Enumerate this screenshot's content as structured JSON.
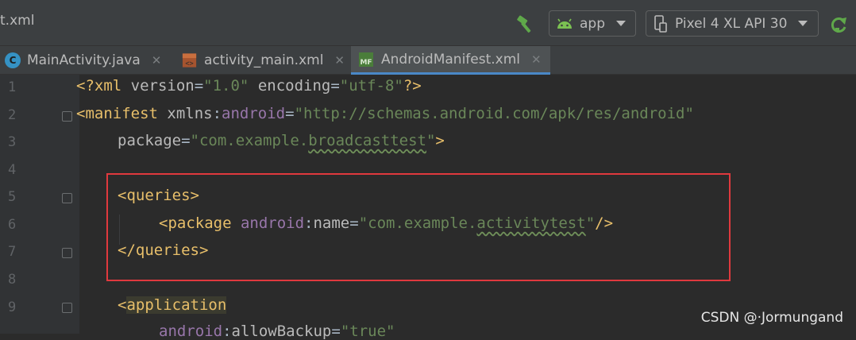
{
  "toolbar": {
    "file_title": "t.xml",
    "app_config": "app",
    "device": "Pixel 4 XL API 30",
    "icons": [
      "hammer-icon",
      "android-icon",
      "device-icon",
      "run-refresh-icon"
    ]
  },
  "tabs": [
    {
      "label": "MainActivity.java",
      "icon": "java-class-icon",
      "active": false
    },
    {
      "label": "activity_main.xml",
      "icon": "layout-xml-icon",
      "active": false
    },
    {
      "label": "AndroidManifest.xml",
      "icon": "manifest-icon",
      "active": true
    }
  ],
  "line_numbers": [
    "1",
    "2",
    "3",
    "4",
    "5",
    "6",
    "7",
    "8",
    "9"
  ],
  "code": {
    "l1": {
      "open": "<?xml ",
      "a1": "version",
      "eq1": "=",
      "s1": "\"1.0\"",
      "a2": " encoding",
      "eq2": "=",
      "s2": "\"utf-8\"",
      "close": "?>"
    },
    "l2": {
      "tag": "<manifest ",
      "attr": "xmlns",
      "colon": ":",
      "ns": "android",
      "eq": "=",
      "str": "\"http://schemas.android.com/apk/res/android\""
    },
    "l3": {
      "attr": "package",
      "eq": "=",
      "str_a": "\"com.example.",
      "str_b": "broadcasttest",
      "str_c": "\"",
      "close": ">"
    },
    "l5": {
      "tag": "<queries>"
    },
    "l6": {
      "tag": "<package ",
      "ns": "android",
      "colon": ":",
      "attr": "name",
      "eq": "=",
      "str_a": "\"com.example.",
      "str_b": "activitytest",
      "str_c": "\"",
      "close": "/>"
    },
    "l7": {
      "tag": "</queries>"
    },
    "l9": {
      "lt": "<",
      "tag": "application"
    },
    "l10": {
      "ns": "android",
      "colon": ":",
      "attr": "allowBackup",
      "eq": "=",
      "str": "\"true\""
    }
  },
  "watermark": "CSDN @·Jormungand",
  "colors": {
    "highlight_box": "#e0393e",
    "tab_underline": "#4a88c7"
  }
}
